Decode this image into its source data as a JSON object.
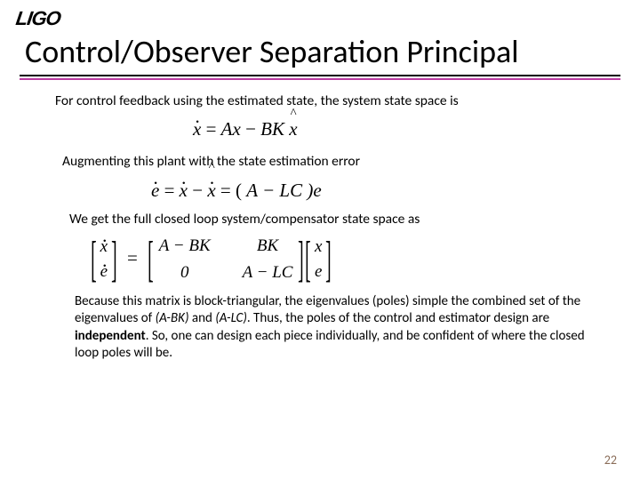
{
  "logo": "LIGO",
  "title": "Control/Observer Separation Principal",
  "p1": "For control feedback using the estimated state, the system state space is",
  "p2": "Augmenting this plant with the state estimation error",
  "p3": "We get the full closed loop system/compensator state space as",
  "p4a": "Because this matrix is block-triangular, the eigenvalues (poles) simple the combined set of the eigenvalues of ",
  "p4b": "(A-BK)",
  "p4c": " and ",
  "p4d": "(A-LC)",
  "p4e": ". Thus, the poles of the control and estimator design are ",
  "p4f": "independent",
  "p4g": ". So, one can design each piece individually, and be confident of where the closed loop poles will be.",
  "eq1": {
    "lhs_var": "x",
    "rhs1": "Ax",
    "minus": " − ",
    "rhs2": "BK",
    "rhs3": "x"
  },
  "eq2": {
    "e": "e",
    "eq": " = ",
    "x1": "x",
    "m": " − ",
    "x2": "x",
    "eq2": " = (",
    "mid": "A − LC",
    "close": ")e"
  },
  "eq3": {
    "lcol": [
      "x",
      "e"
    ],
    "m00": "A − BK",
    "m01": "BK",
    "m10": "0",
    "m11": "A − LC",
    "rcol": [
      "x",
      "e"
    ]
  },
  "pageno": "22"
}
